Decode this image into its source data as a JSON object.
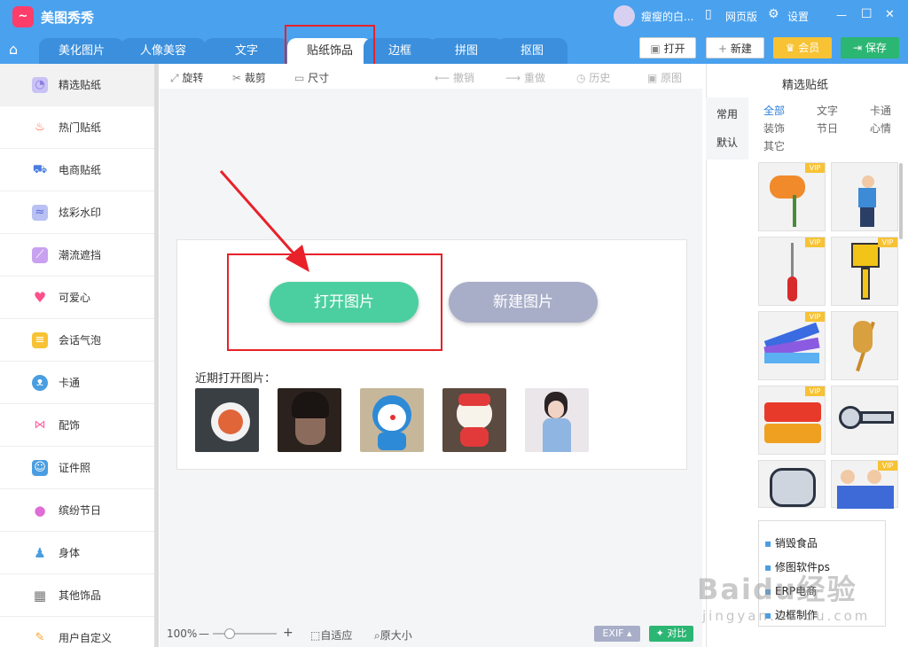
{
  "app": {
    "title": "美图秀秀",
    "logo": "~"
  },
  "titlebar": {
    "user": "瘦瘦的白...",
    "web": "网页版",
    "settings": "设置",
    "min": "—",
    "max": "☐",
    "close": "✕"
  },
  "tabs": [
    {
      "label": "美化图片"
    },
    {
      "label": "人像美容"
    },
    {
      "label": "文字"
    },
    {
      "label": "贴纸饰品"
    },
    {
      "label": "边框"
    },
    {
      "label": "拼图"
    },
    {
      "label": "抠图"
    }
  ],
  "actions": {
    "open": "打开",
    "new": "新建",
    "vip": "会员",
    "save": "保存"
  },
  "sidebar": {
    "items": [
      {
        "label": "精选贴纸",
        "icon": "curated-sticker-icon",
        "color": "#8a7be6"
      },
      {
        "label": "热门贴纸",
        "icon": "flame-icon",
        "color": "#ff5b3a"
      },
      {
        "label": "电商贴纸",
        "icon": "cart-icon",
        "color": "#4a7de0"
      },
      {
        "label": "炫彩水印",
        "icon": "watermark-icon",
        "color": "#7d8ce6"
      },
      {
        "label": "潮流遮挡",
        "icon": "mask-icon",
        "color": "#b07be6"
      },
      {
        "label": "可爱心",
        "icon": "heart-icon",
        "color": "#ff4f8b"
      },
      {
        "label": "会话气泡",
        "icon": "speech-bubble-icon",
        "color": "#f7c234"
      },
      {
        "label": "卡通",
        "icon": "bear-icon",
        "color": "#4a9de0"
      },
      {
        "label": "配饰",
        "icon": "bow-icon",
        "color": "#ff5fa0"
      },
      {
        "label": "证件照",
        "icon": "id-photo-icon",
        "color": "#4a9de0"
      },
      {
        "label": "缤纷节日",
        "icon": "balloon-icon",
        "color": "#e06cd6"
      },
      {
        "label": "身体",
        "icon": "person-icon",
        "color": "#4a9de0"
      },
      {
        "label": "其他饰品",
        "icon": "grid-icon",
        "color": "#777777"
      },
      {
        "label": "用户自定义",
        "icon": "pencil-icon",
        "color": "#f7a534"
      }
    ]
  },
  "toolbar": {
    "rotate": "旋转",
    "crop": "裁剪",
    "size": "尺寸",
    "undo": "撤销",
    "redo": "重做",
    "history": "历史",
    "original": "原图"
  },
  "main": {
    "open_label": "打开图片",
    "new_label": "新建图片",
    "recent_label": "近期打开图片：",
    "thumbs": [
      "food-photo",
      "portrait-photo",
      "doraemon-photo",
      "cartoon-ox-photo",
      "girl-photo"
    ]
  },
  "status": {
    "zoom": "100%",
    "minus": "—",
    "plus": "+",
    "fit": "自适应",
    "actual": "原大小",
    "exif": "EXIF",
    "compare": "对比"
  },
  "right": {
    "title": "精选贴纸",
    "categories": [
      "常用",
      "默认"
    ],
    "filters": [
      "全部",
      "文字",
      "卡通",
      "装饰",
      "节日",
      "心情",
      "其它"
    ],
    "stickers": [
      {
        "name": "orange-flower-sticker",
        "vip": "VIP"
      },
      {
        "name": "painter-sticker",
        "vip": ""
      },
      {
        "name": "screwdriver-sticker",
        "vip": "VIP"
      },
      {
        "name": "paintbrush-sticker",
        "vip": "VIP"
      },
      {
        "name": "color-swatch-sticker",
        "vip": "VIP"
      },
      {
        "name": "wheat-sticker",
        "vip": ""
      },
      {
        "name": "labor-text-sticker",
        "vip": "VIP"
      },
      {
        "name": "bolt-sticker",
        "vip": ""
      },
      {
        "name": "nut-sticker",
        "vip": ""
      },
      {
        "name": "workers-sticker",
        "vip": "VIP"
      }
    ],
    "ad": [
      "销毁食品",
      "修图软件ps",
      "ERP电商",
      "边框制作"
    ]
  },
  "watermark": {
    "brand": "Baidu经验",
    "url": "jingyan.baidu.com"
  }
}
